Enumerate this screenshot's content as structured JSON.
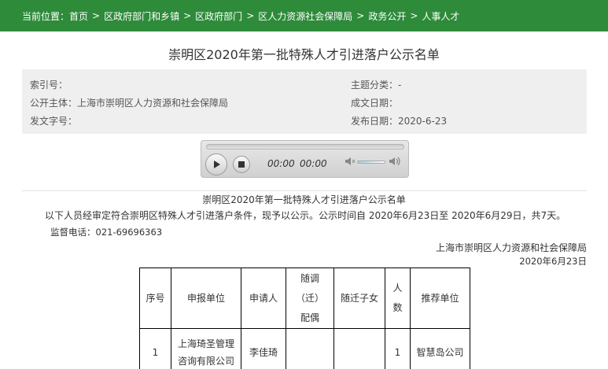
{
  "breadcrumb": {
    "prefix": "当前位置：",
    "items": [
      "首页",
      "区政府部门和乡镇",
      "区政府部门",
      "区人力资源社会保障局",
      "政务公开",
      "人事人才"
    ],
    "separator": ">"
  },
  "page": {
    "title": "崇明区2020年第一批特殊人才引进落户公示名单"
  },
  "meta": {
    "index_label": "索引号：",
    "index_value": "",
    "publisher_label": "公开主体：",
    "publisher_value": "上海市崇明区人力资源和社会保障局",
    "doc_no_label": "发文字号：",
    "doc_no_value": "",
    "category_label": "主题分类：",
    "category_value": "-",
    "created_label": "成文日期：",
    "created_value": "",
    "published_label": "发布日期：",
    "published_value": "2020-6-23"
  },
  "player": {
    "current_time": "00:00",
    "duration": "00:00",
    "progress": 0,
    "volume": 0.6
  },
  "notice": {
    "title": "崇明区2020年第一批特殊人才引进落户公示名单",
    "body": "以下人员经审定符合崇明区特殊人才引进落户条件，现予以公示。公示时间自 2020年6月23日至 2020年6月29日，共7天。",
    "phone": "监督电话：021-69696363",
    "signature_org": "上海市崇明区人力资源和社会保障局",
    "signature_date": "2020年6月23日"
  },
  "table": {
    "headers": [
      "序号",
      "申报单位",
      "申请人",
      "随调（迁）配偶",
      "随迁子女",
      "人数",
      "推荐单位"
    ],
    "rows": [
      [
        "1",
        "上海琦圣管理咨询有限公司",
        "李佳琦",
        "",
        "",
        "1",
        "智慧岛公司"
      ]
    ]
  },
  "colors": {
    "header_green": "#2e8b3a",
    "meta_bg": "#efefef"
  }
}
